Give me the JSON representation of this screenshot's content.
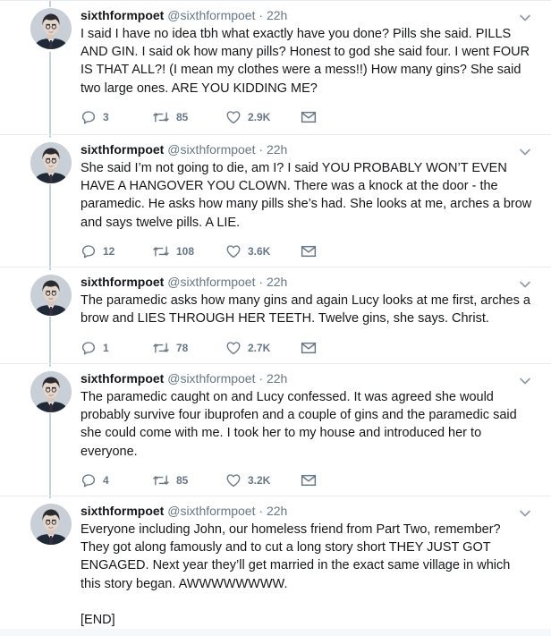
{
  "author": {
    "name": "sixthformpoet",
    "handle": "@sixthformpoet",
    "dot": "·",
    "time": "22h"
  },
  "icons": {
    "reply": "reply-icon",
    "retweet": "retweet-icon",
    "like": "heart-icon",
    "dm": "envelope-icon",
    "more": "chevron-down-icon"
  },
  "colors": {
    "muted": "#657786",
    "thread_line": "#c4cfd6"
  },
  "tweets": [
    {
      "paragraphs": [
        "I said I have no idea tbh what exactly have you done? Pills she said. PILLS AND GIN. I said ok how many pills? Honest to god she said four. I went FOUR IS THAT ALL?! (I mean my clothes were a mess!!) How many gins? She said two large ones. ARE YOU KIDDING ME?"
      ],
      "replies": "3",
      "retweets": "85",
      "likes": "2.9K"
    },
    {
      "paragraphs": [
        "She said I’m not going to die, am I? I said YOU PROBABLY WON’T EVEN HAVE A HANGOVER YOU CLOWN. There was a knock at the door - the paramedic. He asks how many pills she’s had. She looks at me, arches a brow and says twelve pills. A LIE."
      ],
      "replies": "12",
      "retweets": "108",
      "likes": "3.6K"
    },
    {
      "paragraphs": [
        "The paramedic asks how many gins and again Lucy looks at me first, arches a brow and LIES THROUGH HER TEETH. Twelve gins, she says. Christ."
      ],
      "replies": "1",
      "retweets": "78",
      "likes": "2.7K"
    },
    {
      "paragraphs": [
        "The paramedic caught on and Lucy confessed. It was agreed she would probably survive four ibuprofen and a couple of gins and the paramedic said she could come with me. I took her to my house and introduced her to everyone."
      ],
      "replies": "4",
      "retweets": "85",
      "likes": "3.2K"
    },
    {
      "paragraphs": [
        "Everyone including John, our homeless friend from Part Two, remember? They got along famously and to cut a long story short THEY JUST GOT ENGAGED. Next year they’ll get married in the exact same village in which this story began. AWWWWWWWW.",
        "[END]"
      ]
    }
  ]
}
